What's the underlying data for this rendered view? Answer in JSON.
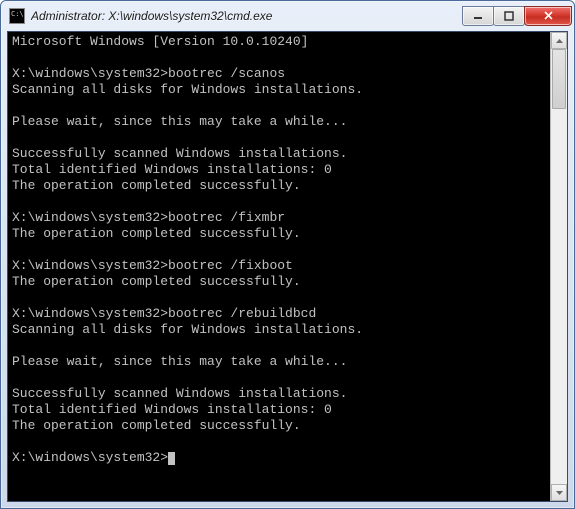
{
  "window": {
    "title": "Administrator: X:\\windows\\system32\\cmd.exe"
  },
  "console": {
    "version_line": "Microsoft Windows [Version 10.0.10240]",
    "prompt": "X:\\windows\\system32>",
    "blocks": [
      {
        "command": "bootrec /scanos",
        "output": [
          "Scanning all disks for Windows installations.",
          "",
          "Please wait, since this may take a while...",
          "",
          "Successfully scanned Windows installations.",
          "Total identified Windows installations: 0",
          "The operation completed successfully."
        ]
      },
      {
        "command": "bootrec /fixmbr",
        "output": [
          "The operation completed successfully."
        ]
      },
      {
        "command": "bootrec /fixboot",
        "output": [
          "The operation completed successfully."
        ]
      },
      {
        "command": "bootrec /rebuildbcd",
        "output": [
          "Scanning all disks for Windows installations.",
          "",
          "Please wait, since this may take a while...",
          "",
          "Successfully scanned Windows installations.",
          "Total identified Windows installations: 0",
          "The operation completed successfully."
        ]
      }
    ]
  },
  "buttons": {
    "minimize": "minimize",
    "maximize": "maximize",
    "close": "close"
  }
}
